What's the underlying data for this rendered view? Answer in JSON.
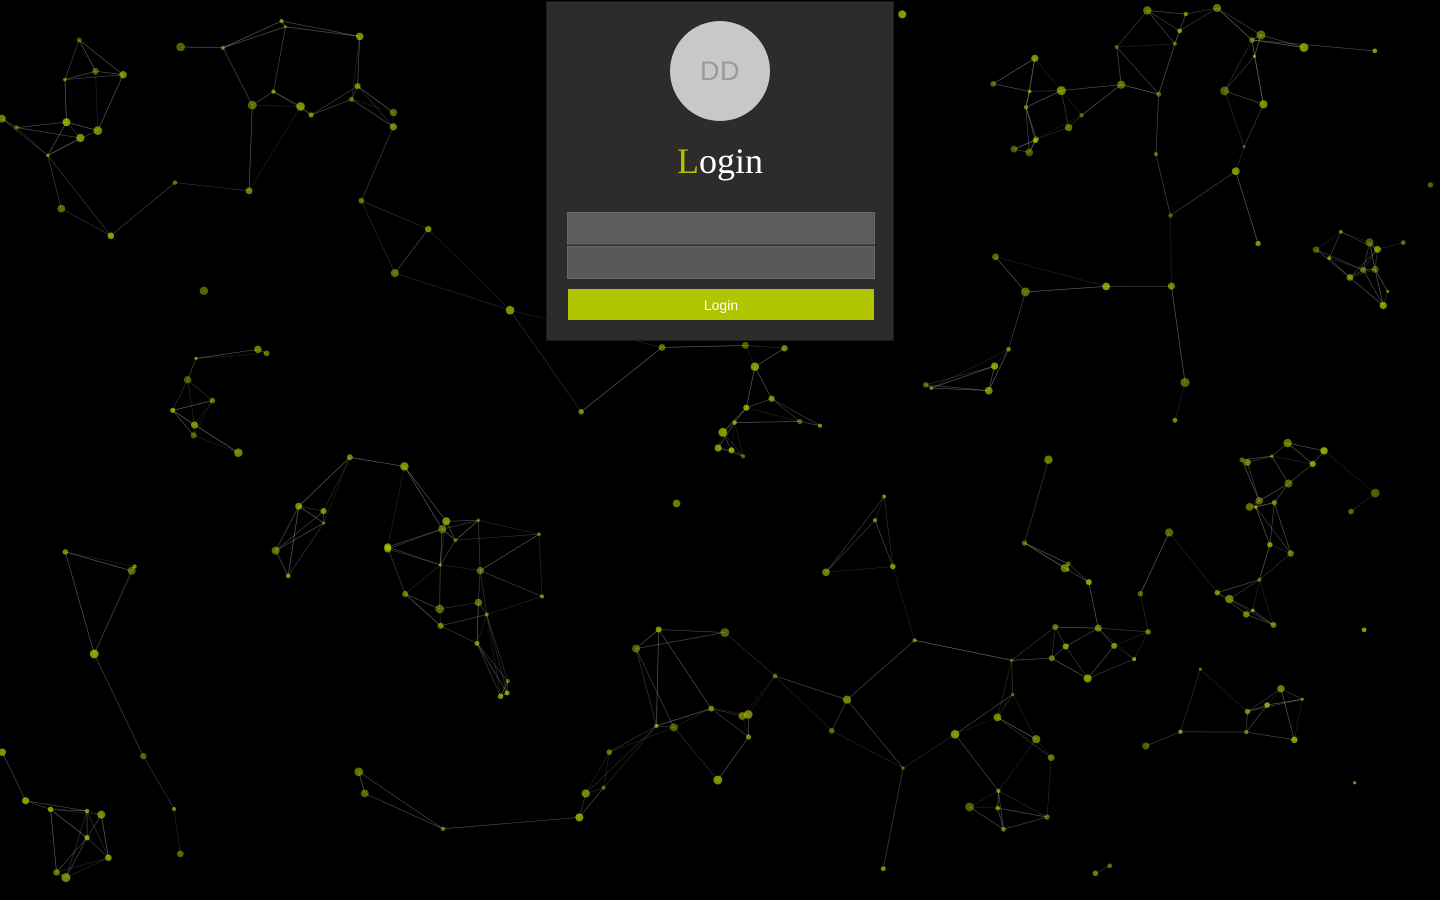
{
  "login": {
    "avatar_initials": "DD",
    "title_first": "L",
    "title_rest": "ogin",
    "username_value": "",
    "password_value": "",
    "button_label": "Login"
  },
  "colors": {
    "accent": "#b1c400",
    "panel_bg": "#2d2c2b",
    "background": "#000000"
  }
}
